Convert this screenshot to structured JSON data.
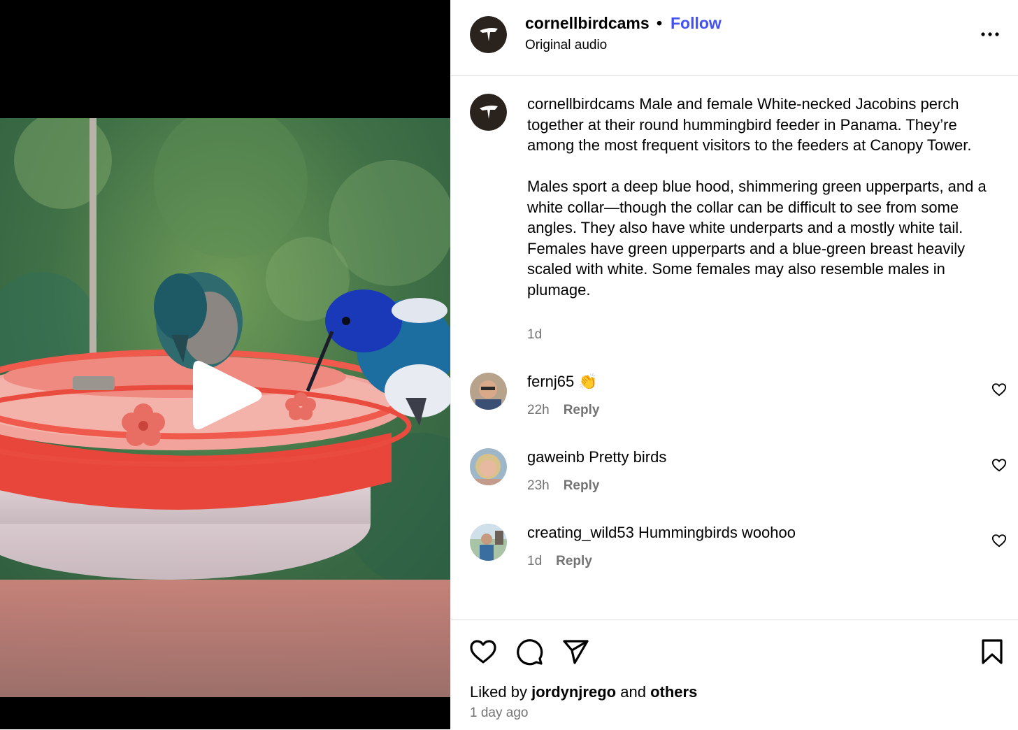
{
  "post": {
    "author": "cornellbirdcams",
    "separator": "•",
    "follow_label": "Follow",
    "audio_label": "Original audio"
  },
  "caption": {
    "username": "cornellbirdcams",
    "paragraph1": "Male and female White-necked Jacobins perch together at their round hummingbird feeder in Panama. They’re among the most frequent visitors to the feeders at Canopy Tower.",
    "paragraph2": "Males sport a deep blue hood, shimmering green upperparts, and a white collar—though the collar can be difficult to see from some angles. They also have white underparts and a mostly white tail. Females have green upperparts and a blue-green breast heavily scaled with white. Some females may also resemble males in plumage.",
    "time": "1d"
  },
  "comments": [
    {
      "username": "fernj65",
      "text": "👏",
      "time": "22h",
      "reply_label": "Reply"
    },
    {
      "username": "gaweinb",
      "text": "Pretty birds",
      "time": "23h",
      "reply_label": "Reply"
    },
    {
      "username": "creating_wild53",
      "text": "Hummingbirds woohoo",
      "time": "1d",
      "reply_label": "Reply"
    }
  ],
  "likes": {
    "prefix": "Liked by",
    "user": "jordynjrego",
    "middle": "and",
    "others": "others"
  },
  "posted_ago": "1 day ago",
  "icons": {
    "more": "more-horizontal-icon",
    "like": "heart-icon",
    "comment": "comment-bubble-icon",
    "share": "send-icon",
    "save": "bookmark-icon",
    "play": "play-icon"
  },
  "colors": {
    "link_blue": "#4150f7",
    "muted_text": "#737373",
    "divider": "#dbdbdb",
    "feeder_red": "#ef4a3e"
  }
}
